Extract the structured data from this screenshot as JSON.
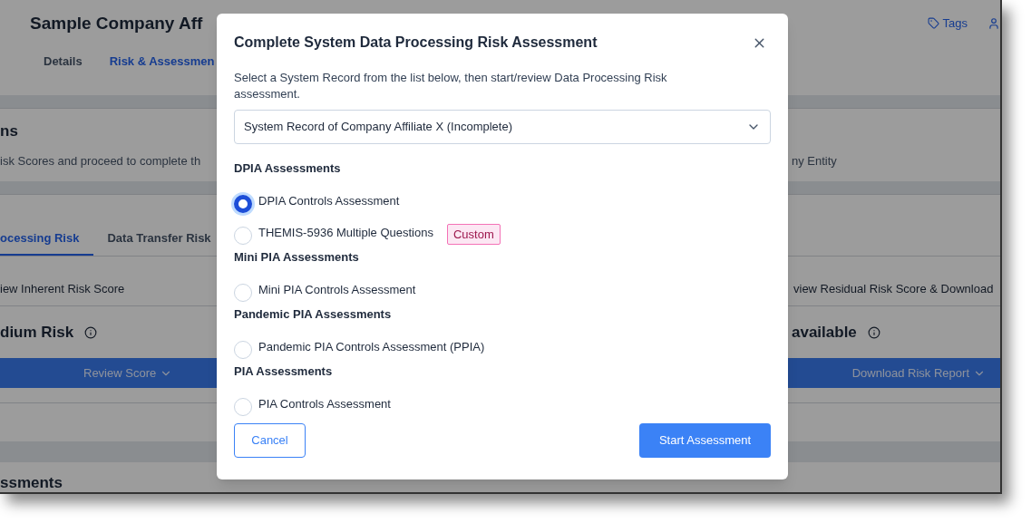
{
  "page": {
    "title": "Sample Company Aff",
    "tabs": [
      {
        "label": "Details",
        "selected": false
      },
      {
        "label": "Risk & Assessmen",
        "selected": true
      }
    ],
    "tags_link": "Tags",
    "intro": {
      "heading": "ns",
      "text": "isk Scores and proceed to complete th",
      "text_right": "ny Entity"
    },
    "risk_tabs": [
      {
        "label": "ocessing Risk",
        "selected": true
      },
      {
        "label": "Data Transfer Risk",
        "selected": false
      }
    ],
    "step_left": "iew Inherent Risk Score",
    "step_right": "view Residual Risk Score & Download",
    "score_left": "dium Risk",
    "score_right": "available",
    "review_button": "Review Score",
    "download_button": "Download Risk Report",
    "bottom_heading": "ssments"
  },
  "modal": {
    "title": "Complete System Data Processing Risk Assessment",
    "description": "Select a System Record from the list below, then start/review Data Processing Risk assessment.",
    "select_value": "System Record of Company Affiliate X (Incomplete)",
    "groups": [
      {
        "heading": "DPIA Assessments",
        "options": [
          {
            "label": "DPIA Controls Assessment",
            "selected": true
          },
          {
            "label": "THEMIS-5936 Multiple Questions",
            "selected": false,
            "badge": "Custom"
          }
        ]
      },
      {
        "heading": "Mini PIA Assessments",
        "options": [
          {
            "label": "Mini PIA Controls Assessment",
            "selected": false
          }
        ]
      },
      {
        "heading": "Pandemic PIA Assessments",
        "options": [
          {
            "label": "Pandemic PIA Controls Assessment (PPIA)",
            "selected": false
          }
        ]
      },
      {
        "heading": "PIA Assessments",
        "options": [
          {
            "label": "PIA Controls Assessment",
            "selected": false
          }
        ]
      }
    ],
    "cancel": "Cancel",
    "start": "Start Assessment"
  }
}
